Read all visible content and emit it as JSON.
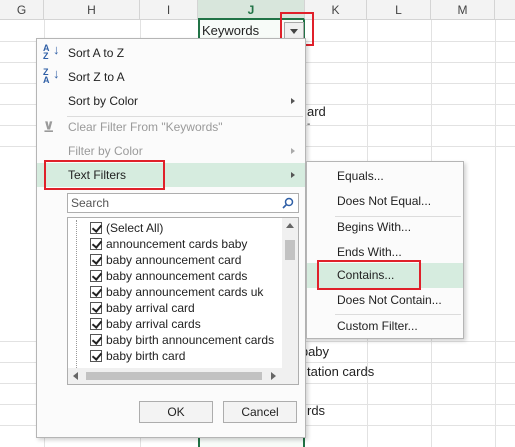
{
  "columns": [
    "G",
    "H",
    "I",
    "J",
    "K",
    "L",
    "M"
  ],
  "selected_column": "J",
  "header_cell": "Keywords",
  "background_fragments": [
    "ard",
    "h baby",
    "tation cards",
    "rds"
  ],
  "menu": {
    "sort_a_z": "Sort A to Z",
    "sort_z_a": "Sort Z to A",
    "sort_by_color": "Sort by Color",
    "clear_filter": "Clear Filter From \"Keywords\"",
    "filter_by_color": "Filter by Color",
    "text_filters": "Text Filters",
    "search_placeholder": "Search",
    "items": [
      "(Select All)",
      "announcement cards baby",
      "baby announcement card",
      "baby announcement cards",
      "baby announcement cards uk",
      "baby arrival card",
      "baby arrival cards",
      "baby birth announcement cards",
      "baby birth card"
    ],
    "ok": "OK",
    "cancel": "Cancel"
  },
  "submenu": {
    "equals": "Equals...",
    "not_equal": "Does Not Equal...",
    "begins_with": "Begins With...",
    "ends_with": "Ends With...",
    "contains": "Contains...",
    "not_contain": "Does Not Contain...",
    "custom_filter": "Custom Filter..."
  },
  "colors": {
    "highlight": "#d6ecdf",
    "accent": "#217346",
    "callout": "#e0202a"
  },
  "icons": [
    "sort-ascending-icon",
    "sort-descending-icon",
    "clear-filter-icon",
    "search-icon",
    "dropdown-arrow-icon",
    "checkbox-icon",
    "submenu-arrow-icon"
  ]
}
